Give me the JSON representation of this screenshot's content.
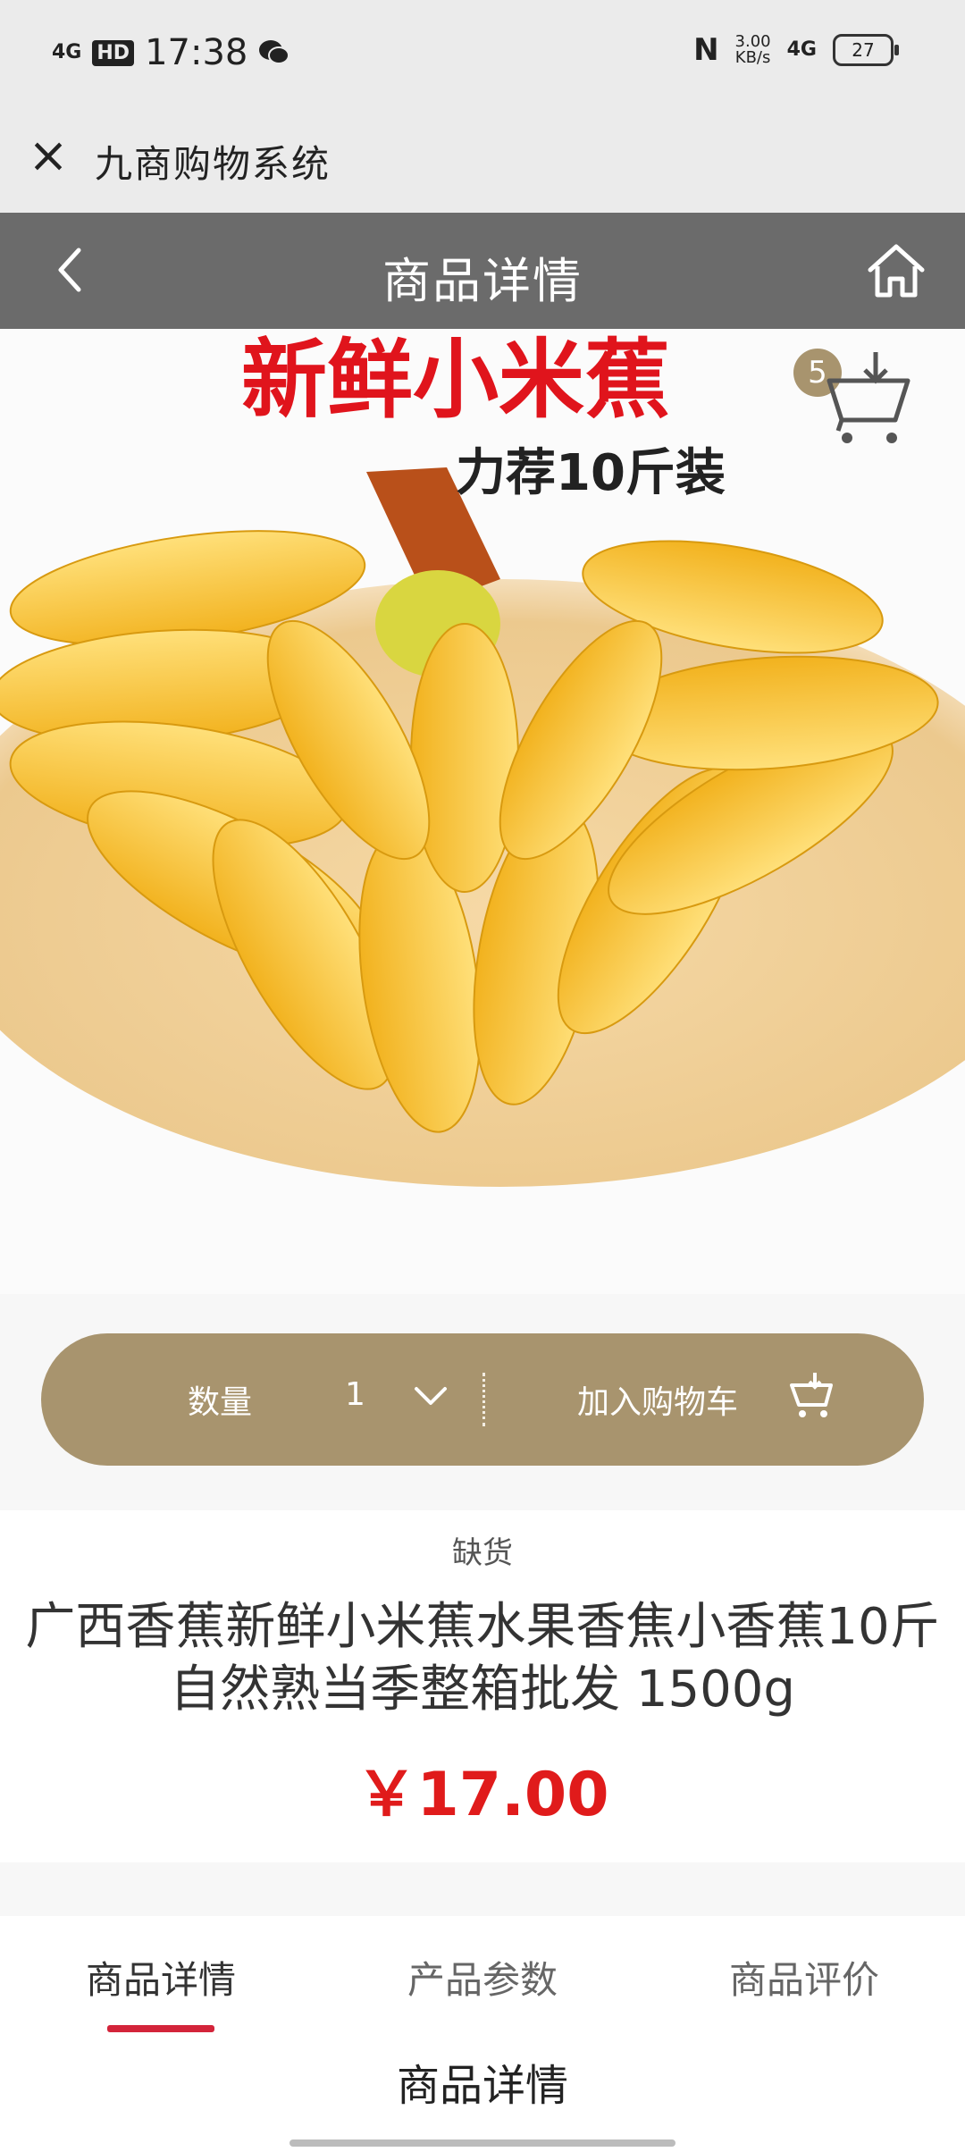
{
  "status_bar": {
    "signal": "4G",
    "hd": "HD",
    "time": "17:38",
    "wechat_icon": "wechat-icon",
    "nfc": "N",
    "net_speed_value": "3.00",
    "net_speed_unit": "KB/s",
    "network": "4G",
    "battery": "27"
  },
  "browser": {
    "title": "九商购物系统"
  },
  "nav": {
    "title": "商品详情"
  },
  "image": {
    "headline": "新鲜小米蕉",
    "subline": "力荐10斤装",
    "cart_count": "5"
  },
  "actions": {
    "qty_label": "数量",
    "qty_value": "1",
    "add_to_cart": "加入购物车"
  },
  "product": {
    "stock_status": "缺货",
    "title": "广西香蕉新鲜小米蕉水果香焦小香蕉10斤自然熟当季整箱批发 1500g",
    "price": "￥17.00"
  },
  "tabs": [
    {
      "label": "商品详情",
      "active": true
    },
    {
      "label": "产品参数",
      "active": false
    },
    {
      "label": "商品评价",
      "active": false
    }
  ],
  "section_title": "商品详情",
  "colors": {
    "accent": "#a8946e",
    "price": "#e01b1b",
    "tab_indicator": "#d3243a",
    "nav_bg": "#6b6b6b"
  }
}
